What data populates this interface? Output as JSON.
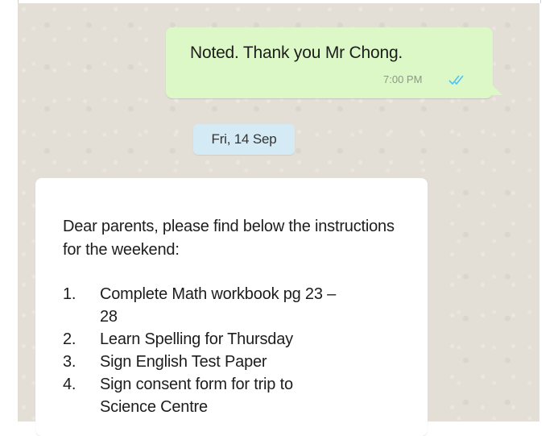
{
  "messages": {
    "outgoing": {
      "text": "Noted. Thank you Mr Chong.",
      "time": "7:00 PM",
      "status_icon": "double-check-icon"
    },
    "date_separator": "Fri, 14 Sep",
    "incoming": {
      "intro": "Dear parents, please find below the instructions for the weekend:",
      "items": [
        {
          "num": "1.",
          "text": "Complete Math workbook pg 23 – 28"
        },
        {
          "num": "2.",
          "text": "Learn Spelling for Thursday"
        },
        {
          "num": "3.",
          "text": "Sign English Test Paper"
        },
        {
          "num": "4.",
          "text": "Sign consent form for trip to Science Centre"
        }
      ]
    }
  },
  "colors": {
    "chat_background": "#e3dfd7",
    "outgoing_bubble": "#dcf8c6",
    "incoming_bubble": "#ffffff",
    "date_chip": "#d4eaf4",
    "read_ticks": "#4fc3f7"
  }
}
